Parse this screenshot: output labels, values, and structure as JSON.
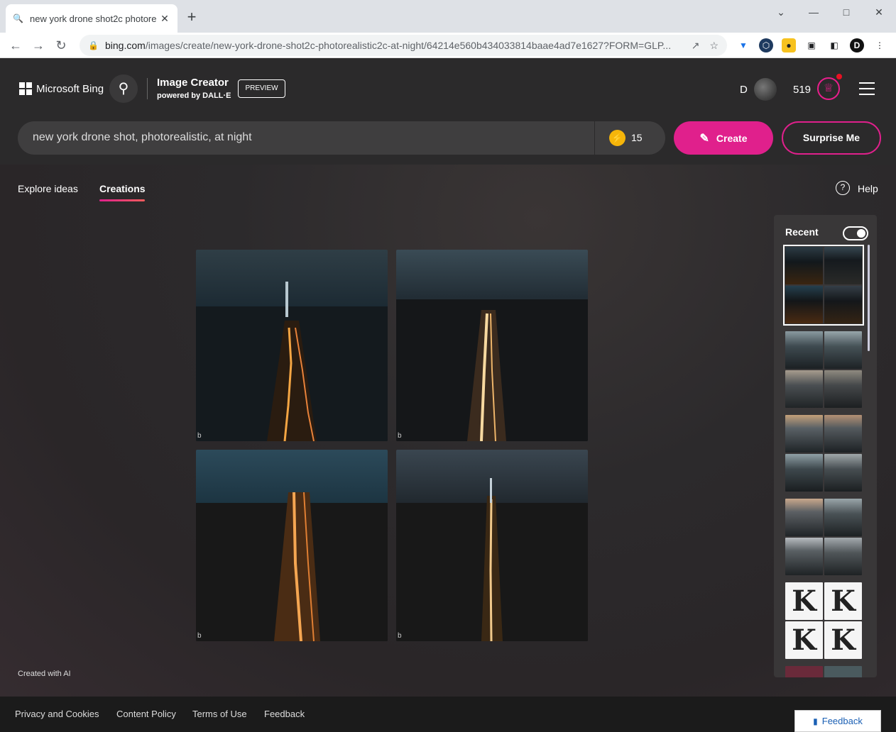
{
  "browser": {
    "tab_title": "new york drone shot2c photore",
    "url_domain": "bing.com",
    "url_path": "/images/create/new-york-drone-shot2c-photorealistic2c-at-night/64214e560b434033814baae4ad7e1627?FORM=GLP..."
  },
  "bing": {
    "logo_text": "Microsoft Bing",
    "product_title": "Image Creator",
    "product_sub": "powered by DALL·E",
    "preview_badge": "PREVIEW",
    "user_initial": "D",
    "points": "519",
    "prompt": "new york drone shot, photorealistic, at night",
    "boosts": "15",
    "create_label": "Create",
    "surprise_label": "Surprise Me"
  },
  "nav": {
    "explore": "Explore ideas",
    "creations": "Creations",
    "help": "Help"
  },
  "recent": {
    "label": "Recent",
    "letter": "K"
  },
  "created_with": "Created with AI",
  "footer": {
    "privacy": "Privacy and Cookies",
    "content_policy": "Content Policy",
    "terms": "Terms of Use",
    "feedback": "Feedback",
    "feedback_button": "Feedback"
  },
  "colors": {
    "accent": "#e0208c",
    "background": "#2b2a2b",
    "boost": "#f5b50a"
  }
}
